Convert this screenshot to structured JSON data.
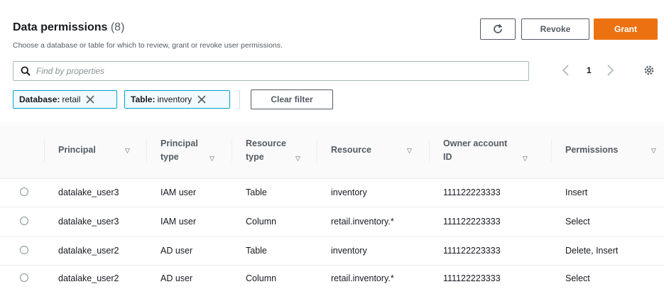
{
  "header": {
    "title": "Data permissions",
    "count": "(8)",
    "subtitle": "Choose a database or table for which to review, grant or revoke user permissions."
  },
  "actions": {
    "refresh_icon": "refresh-icon",
    "revoke_label": "Revoke",
    "grant_label": "Grant"
  },
  "search": {
    "placeholder": "Find by properties",
    "value": ""
  },
  "pagination": {
    "current_page": "1"
  },
  "filters": [
    {
      "key": "Database:",
      "value": "retail"
    },
    {
      "key": "Table:",
      "value": "inventory"
    }
  ],
  "clear_filter_label": "Clear filter",
  "table": {
    "headers": {
      "principal": "Principal",
      "principal_type_1": "Principal",
      "principal_type_2": "type",
      "resource_type_1": "Resource",
      "resource_type_2": "type",
      "resource": "Resource",
      "owner_1": "Owner account",
      "owner_2": "ID",
      "permissions": "Permissions"
    },
    "rows": [
      {
        "principal": "datalake_user3",
        "principal_type": "IAM user",
        "resource_type": "Table",
        "resource": "inventory",
        "owner": "111122223333",
        "permissions": "Insert"
      },
      {
        "principal": "datalake_user3",
        "principal_type": "IAM user",
        "resource_type": "Column",
        "resource": "retail.inventory.*",
        "owner": "111122223333",
        "permissions": "Select"
      },
      {
        "principal": "datalake_user2",
        "principal_type": "AD user",
        "resource_type": "Table",
        "resource": "inventory",
        "owner": "111122223333",
        "permissions": "Delete, Insert"
      },
      {
        "principal": "datalake_user2",
        "principal_type": "AD user",
        "resource_type": "Column",
        "resource": "retail.inventory.*",
        "owner": "111122223333",
        "permissions": "Select"
      }
    ]
  },
  "colors": {
    "accent": "#ec7211",
    "token_border": "#00a1c9",
    "token_bg": "#f1faff"
  }
}
